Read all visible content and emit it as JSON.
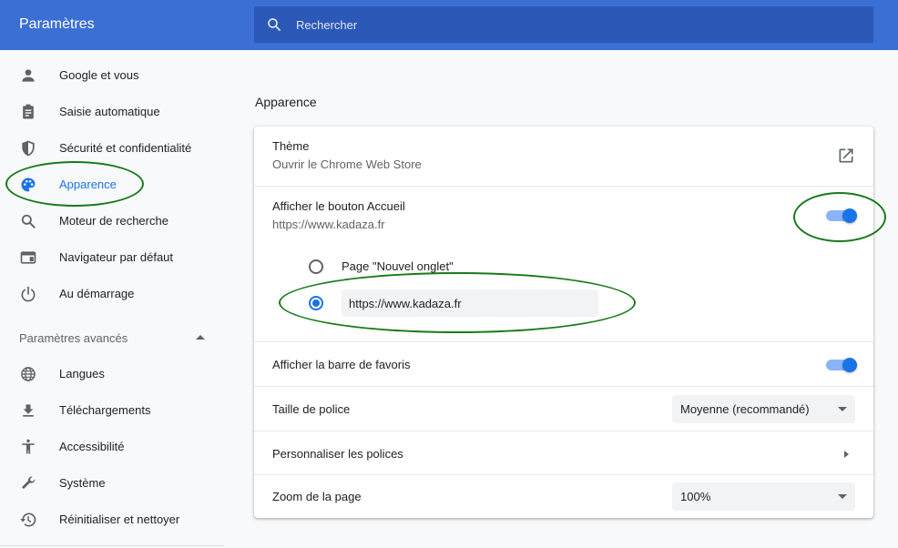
{
  "header": {
    "title": "Paramètres",
    "search_placeholder": "Rechercher"
  },
  "sidebar": {
    "items": [
      {
        "label": "Google et vous",
        "icon": "person-icon"
      },
      {
        "label": "Saisie automatique",
        "icon": "clipboard-icon"
      },
      {
        "label": "Sécurité et confidentialité",
        "icon": "shield-icon"
      },
      {
        "label": "Apparence",
        "icon": "palette-icon",
        "active": true
      },
      {
        "label": "Moteur de recherche",
        "icon": "search-icon"
      },
      {
        "label": "Navigateur par défaut",
        "icon": "browser-icon"
      },
      {
        "label": "Au démarrage",
        "icon": "power-icon"
      }
    ],
    "advanced_label": "Paramètres avancés",
    "advanced_items": [
      {
        "label": "Langues",
        "icon": "globe-icon"
      },
      {
        "label": "Téléchargements",
        "icon": "download-icon"
      },
      {
        "label": "Accessibilité",
        "icon": "accessibility-icon"
      },
      {
        "label": "Système",
        "icon": "wrench-icon"
      },
      {
        "label": "Réinitialiser et nettoyer",
        "icon": "restore-icon"
      }
    ]
  },
  "main": {
    "section_title": "Apparence",
    "theme": {
      "title": "Thème",
      "subtitle": "Ouvrir le Chrome Web Store"
    },
    "home_button": {
      "title": "Afficher le bouton Accueil",
      "subtitle": "https://www.kadaza.fr",
      "enabled": true,
      "option_new_tab": "Page \"Nouvel onglet\"",
      "custom_url": "https://www.kadaza.fr",
      "selected_option": "custom_url"
    },
    "bookmarks_bar": {
      "title": "Afficher la barre de favoris",
      "enabled": true
    },
    "font_size": {
      "title": "Taille de police",
      "value": "Moyenne (recommandé)"
    },
    "customize_fonts": {
      "title": "Personnaliser les polices"
    },
    "page_zoom": {
      "title": "Zoom de la page",
      "value": "100%"
    }
  },
  "colors": {
    "header_bg": "#3b6fd4",
    "accent": "#1a73e8",
    "annotation": "#1a7a1a"
  }
}
